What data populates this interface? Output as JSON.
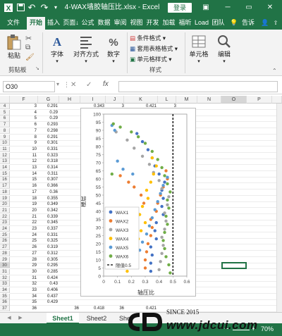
{
  "window": {
    "title": "4-WAX墙胶轴压比.xlsx - Excel",
    "login": "登录",
    "qa_undo": "↶",
    "qa_redo": "↷",
    "minimize": "─",
    "restore": "▭",
    "close": "✕",
    "ribbon_toggle": "▣"
  },
  "menu": {
    "tabs": [
      "文件",
      "开始",
      "插入",
      "页面↓",
      "公式",
      "数据",
      "审阅",
      "视图",
      "开发",
      "加载",
      "福昕",
      "Load",
      "团队"
    ],
    "active": 1,
    "tell": "告诉"
  },
  "ribbon": {
    "paste": "粘贴",
    "clipboard_group": "剪贴板",
    "font": "字体",
    "align": "对齐方式",
    "number": "数字",
    "cond_format": "条件格式",
    "table_format": "套用表格格式",
    "cell_style": "单元格样式",
    "styles_group": "样式",
    "cells": "单元格",
    "edit": "编辑"
  },
  "formula_bar": {
    "name_box": "O30",
    "fx": "fx",
    "cancel": "✕",
    "enter": "✓",
    "value": ""
  },
  "columns": [
    "F",
    "G",
    "H",
    "I",
    "J",
    "K",
    "L",
    "M",
    "N",
    "O",
    "P"
  ],
  "rows": {
    "numbers": [
      4,
      5,
      6,
      7,
      8,
      9,
      10,
      11,
      12,
      13,
      14,
      15,
      16,
      17,
      18,
      19,
      20,
      21,
      22,
      23,
      24,
      25,
      26,
      27,
      28,
      29,
      30,
      31,
      32,
      33,
      34,
      35,
      36,
      37
    ],
    "f": [
      3,
      4,
      5,
      6,
      7,
      8,
      9,
      10,
      11,
      12,
      13,
      14,
      15,
      16,
      17,
      18,
      19,
      20,
      21,
      22,
      23,
      24,
      25,
      26,
      27,
      28,
      29,
      30,
      31,
      32,
      33,
      34,
      35,
      36
    ],
    "g": [
      "0.291",
      "0.29",
      "0.29",
      "0.293",
      "0.298",
      "0.291",
      "0.301",
      "0.331",
      "0.323",
      "0.318",
      "0.314",
      "0.311",
      "0.307",
      "0.366",
      "0.36",
      "0.355",
      "0.349",
      "0.342",
      "0.339",
      "0.345",
      "0.337",
      "0.331",
      "0.325",
      "0.319",
      "0.312",
      "0.305",
      "0.295",
      "0.285",
      "0.424",
      "0.43",
      "0.406",
      "0.437",
      "0.429",
      ""
    ]
  },
  "top_row": {
    "i": "0.343",
    "j": "3",
    "k": "0.421",
    "l": "3"
  },
  "bottom_row": {
    "h": "36",
    "i": "0.418",
    "j": "36",
    "k": "0.421"
  },
  "chart_data": {
    "type": "scatter",
    "ylabel": "楼层",
    "xlabel": "轴压比",
    "xlim": [
      0,
      0.6
    ],
    "ylim": [
      0,
      100
    ],
    "xticks": [
      "0",
      "0.1",
      "0.2",
      "0.3",
      "0.4",
      "0.5",
      "0.6"
    ],
    "yticks": [
      "0",
      "5",
      "10",
      "15",
      "20",
      "25",
      "30",
      "35",
      "40",
      "45",
      "50",
      "55",
      "60",
      "65",
      "70",
      "75",
      "80",
      "85",
      "90",
      "95",
      "100"
    ],
    "limit_line": {
      "name": "限值0.5",
      "x": 0.5,
      "color": "#000000"
    },
    "series": [
      {
        "name": "WAX1",
        "color": "#4472c4",
        "points": [
          [
            0.34,
            3
          ],
          [
            0.34,
            8
          ],
          [
            0.35,
            13
          ],
          [
            0.34,
            18
          ],
          [
            0.38,
            23
          ],
          [
            0.37,
            28
          ],
          [
            0.38,
            33
          ],
          [
            0.43,
            38
          ],
          [
            0.42,
            43
          ],
          [
            0.43,
            48
          ],
          [
            0.42,
            53
          ],
          [
            0.44,
            58
          ],
          [
            0.4,
            63
          ],
          [
            0.37,
            68
          ],
          [
            0.35,
            73
          ],
          [
            0.32,
            78
          ],
          [
            0.28,
            83
          ],
          [
            0.24,
            88
          ]
        ]
      },
      {
        "name": "WAX2",
        "color": "#ed7d31",
        "points": [
          [
            0.3,
            5
          ],
          [
            0.3,
            10
          ],
          [
            0.31,
            15
          ],
          [
            0.32,
            20
          ],
          [
            0.34,
            25
          ],
          [
            0.35,
            30
          ],
          [
            0.34,
            35
          ],
          [
            0.38,
            40
          ],
          [
            0.39,
            45
          ],
          [
            0.41,
            50
          ],
          [
            0.43,
            55
          ],
          [
            0.46,
            60
          ],
          [
            0.45,
            65
          ],
          [
            0.12,
            62
          ],
          [
            0.18,
            58
          ],
          [
            0.22,
            55
          ],
          [
            0.27,
            50
          ],
          [
            0.29,
            45
          ]
        ]
      },
      {
        "name": "WAX3",
        "color": "#a5a5a5",
        "points": [
          [
            0.4,
            4
          ],
          [
            0.41,
            9
          ],
          [
            0.42,
            14
          ],
          [
            0.43,
            19
          ],
          [
            0.42,
            24
          ],
          [
            0.44,
            29
          ],
          [
            0.45,
            34
          ],
          [
            0.44,
            39
          ],
          [
            0.46,
            44
          ],
          [
            0.47,
            49
          ],
          [
            0.42,
            54
          ],
          [
            0.4,
            59
          ],
          [
            0.36,
            64
          ],
          [
            0.33,
            69
          ],
          [
            0.28,
            74
          ],
          [
            0.22,
            79
          ],
          [
            0.17,
            84
          ],
          [
            0.09,
            89
          ]
        ]
      },
      {
        "name": "WAX4",
        "color": "#ffc000",
        "points": [
          [
            0.17,
            3
          ],
          [
            0.19,
            8
          ],
          [
            0.21,
            13
          ],
          [
            0.23,
            18
          ],
          [
            0.25,
            23
          ],
          [
            0.27,
            28
          ],
          [
            0.3,
            33
          ],
          [
            0.26,
            38
          ],
          [
            0.28,
            43
          ],
          [
            0.32,
            48
          ],
          [
            0.31,
            53
          ],
          [
            0.34,
            58
          ],
          [
            0.36,
            63
          ],
          [
            0.38,
            68
          ],
          [
            0.35,
            73
          ]
        ]
      },
      {
        "name": "WAX5",
        "color": "#5b9bd5",
        "points": [
          [
            0.22,
            6
          ],
          [
            0.24,
            11
          ],
          [
            0.26,
            16
          ],
          [
            0.28,
            21
          ],
          [
            0.31,
            26
          ],
          [
            0.33,
            31
          ],
          [
            0.35,
            36
          ],
          [
            0.37,
            41
          ],
          [
            0.39,
            46
          ],
          [
            0.41,
            51
          ],
          [
            0.43,
            56
          ],
          [
            0.46,
            61
          ],
          [
            0.21,
            63
          ],
          [
            0.14,
            66
          ],
          [
            0.1,
            71
          ],
          [
            0.06,
            93
          ],
          [
            0.08,
            90
          ]
        ]
      },
      {
        "name": "WAX6",
        "color": "#70ad47",
        "points": [
          [
            0.48,
            2
          ],
          [
            0.47,
            7
          ],
          [
            0.45,
            12
          ],
          [
            0.44,
            17
          ],
          [
            0.43,
            22
          ],
          [
            0.44,
            27
          ],
          [
            0.46,
            32
          ],
          [
            0.45,
            37
          ],
          [
            0.47,
            42
          ],
          [
            0.46,
            47
          ],
          [
            0.48,
            52
          ],
          [
            0.46,
            57
          ],
          [
            0.44,
            62
          ],
          [
            0.42,
            67
          ],
          [
            0.39,
            72
          ],
          [
            0.35,
            77
          ],
          [
            0.3,
            82
          ],
          [
            0.25,
            86
          ],
          [
            0.2,
            89
          ],
          [
            0.12,
            92
          ],
          [
            0.07,
            94
          ],
          [
            0.06,
            63
          ]
        ]
      }
    ]
  },
  "sheets": {
    "tabs": [
      "Sheet1",
      "Sheet2",
      "She"
    ],
    "active": 0,
    "prev": "◀",
    "next": "▶"
  },
  "watermark": {
    "since": "SINCE 2015",
    "site": "www.jdcui.com"
  },
  "status": {
    "zoom": "70%",
    "zoom_minus": "−",
    "zoom_plus": "+"
  }
}
